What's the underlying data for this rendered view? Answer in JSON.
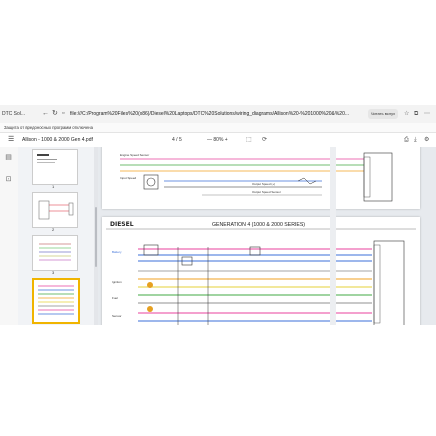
{
  "browser": {
    "tab_label": "DTC Sol...",
    "url": "file:///C:/Program%20Files%20(x86)/Diesel%20Laptops/DTC%20Solutions/wiring_diagrams/Allison%20-%201000%20&%20...",
    "read_aloud_label": "Читать вслух",
    "notice": "Защита от вредоносных программ отключена"
  },
  "pdf_toolbar": {
    "file_title": "Allison - 1000 & 2000 Gen 4.pdf",
    "current_page": "4",
    "total_pages": "/ 5",
    "zoom": "— 80% +"
  },
  "thumbnails": [
    {
      "number": "1"
    },
    {
      "number": "2"
    },
    {
      "number": "3"
    },
    {
      "number": "4",
      "selected": true
    }
  ],
  "page_content": {
    "logo_text": "DIESEL",
    "title": "GENERATION 4 (1000 & 2000 SERIES)",
    "upper_labels": [
      "Engine Speed Sensor",
      "Input Speed",
      "Output Speed (+)",
      "Output Speed Sensor"
    ],
    "lower_labels": [
      "Battery",
      "Ignition",
      "Fuel",
      "Sensor"
    ]
  },
  "colors": {
    "accent": "#f0b400",
    "wire_pink": "#e8409c",
    "wire_blue": "#3b6fd8",
    "wire_green": "#41a843",
    "wire_orange": "#f0a020",
    "wire_yellow": "#e6d13a"
  }
}
